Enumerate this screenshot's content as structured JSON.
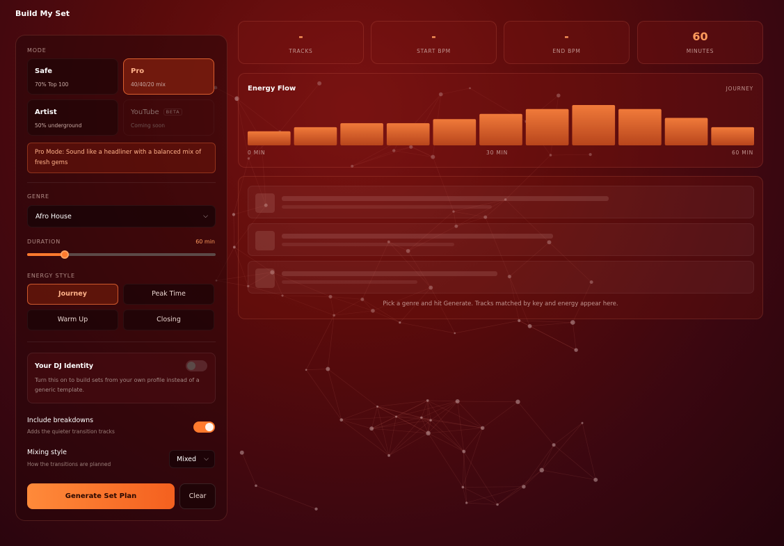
{
  "page": {
    "title": "Build My Set"
  },
  "mode": {
    "label": "MODE",
    "options": [
      {
        "name": "Safe",
        "sub": "70% Top 100",
        "state": "normal"
      },
      {
        "name": "Pro",
        "sub": "40/40/20 mix",
        "state": "active"
      },
      {
        "name": "Artist",
        "sub": "50% underground",
        "state": "normal"
      },
      {
        "name": "YouTube",
        "badge": "BETA",
        "sub": "Coming soon",
        "state": "disabled"
      }
    ],
    "note": "Pro Mode: Sound like a headliner with a balanced mix of fresh gems"
  },
  "genre": {
    "label": "GENRE",
    "value": "Afro House"
  },
  "duration": {
    "label": "DURATION",
    "value_text": "60 min",
    "fraction": 0.2
  },
  "energy_style": {
    "label": "ENERGY STYLE",
    "options": [
      {
        "name": "Journey",
        "active": true
      },
      {
        "name": "Peak Time",
        "active": false
      },
      {
        "name": "Warm Up",
        "active": false
      },
      {
        "name": "Closing",
        "active": false
      }
    ]
  },
  "identity": {
    "title": "Your DJ Identity",
    "desc": "Turn this on to build sets from your own profile instead of a generic template.",
    "enabled": false
  },
  "breakdowns": {
    "title": "Include breakdowns",
    "sub": "Adds the quieter transition tracks",
    "enabled": true
  },
  "mixing": {
    "title": "Mixing style",
    "sub": "How the transitions are planned",
    "value": "Mixed"
  },
  "actions": {
    "generate": "Generate Set Plan",
    "clear": "Clear"
  },
  "stats": [
    {
      "value": "-",
      "label": "TRACKS"
    },
    {
      "value": "-",
      "label": "START BPM"
    },
    {
      "value": "-",
      "label": "END BPM"
    },
    {
      "value": "60",
      "label": "MINUTES"
    }
  ],
  "energy_flow": {
    "title": "Energy Flow",
    "tag": "JOURNEY",
    "x_ticks": [
      "0 MIN",
      "30 MIN",
      "60 MIN"
    ]
  },
  "chart_data": {
    "type": "bar",
    "title": "Energy Flow",
    "values": [
      0.35,
      0.45,
      0.55,
      0.55,
      0.65,
      0.78,
      0.9,
      1.0,
      0.9,
      0.68,
      0.45
    ],
    "ylim": [
      0,
      1
    ],
    "xlabel": "",
    "ylabel": ""
  },
  "tracks": {
    "placeholder_rows": [
      {
        "w1": 470,
        "w2": 302
      },
      {
        "w1": 390,
        "w2": 248
      },
      {
        "w1": 310,
        "w2": 195
      }
    ],
    "empty_message": "Pick a genre and hit Generate. Tracks matched by key and energy appear here."
  },
  "colors": {
    "accent": "#ff7a2e",
    "bar_top": "#f07a3a",
    "bar_bottom": "#b8451c"
  }
}
